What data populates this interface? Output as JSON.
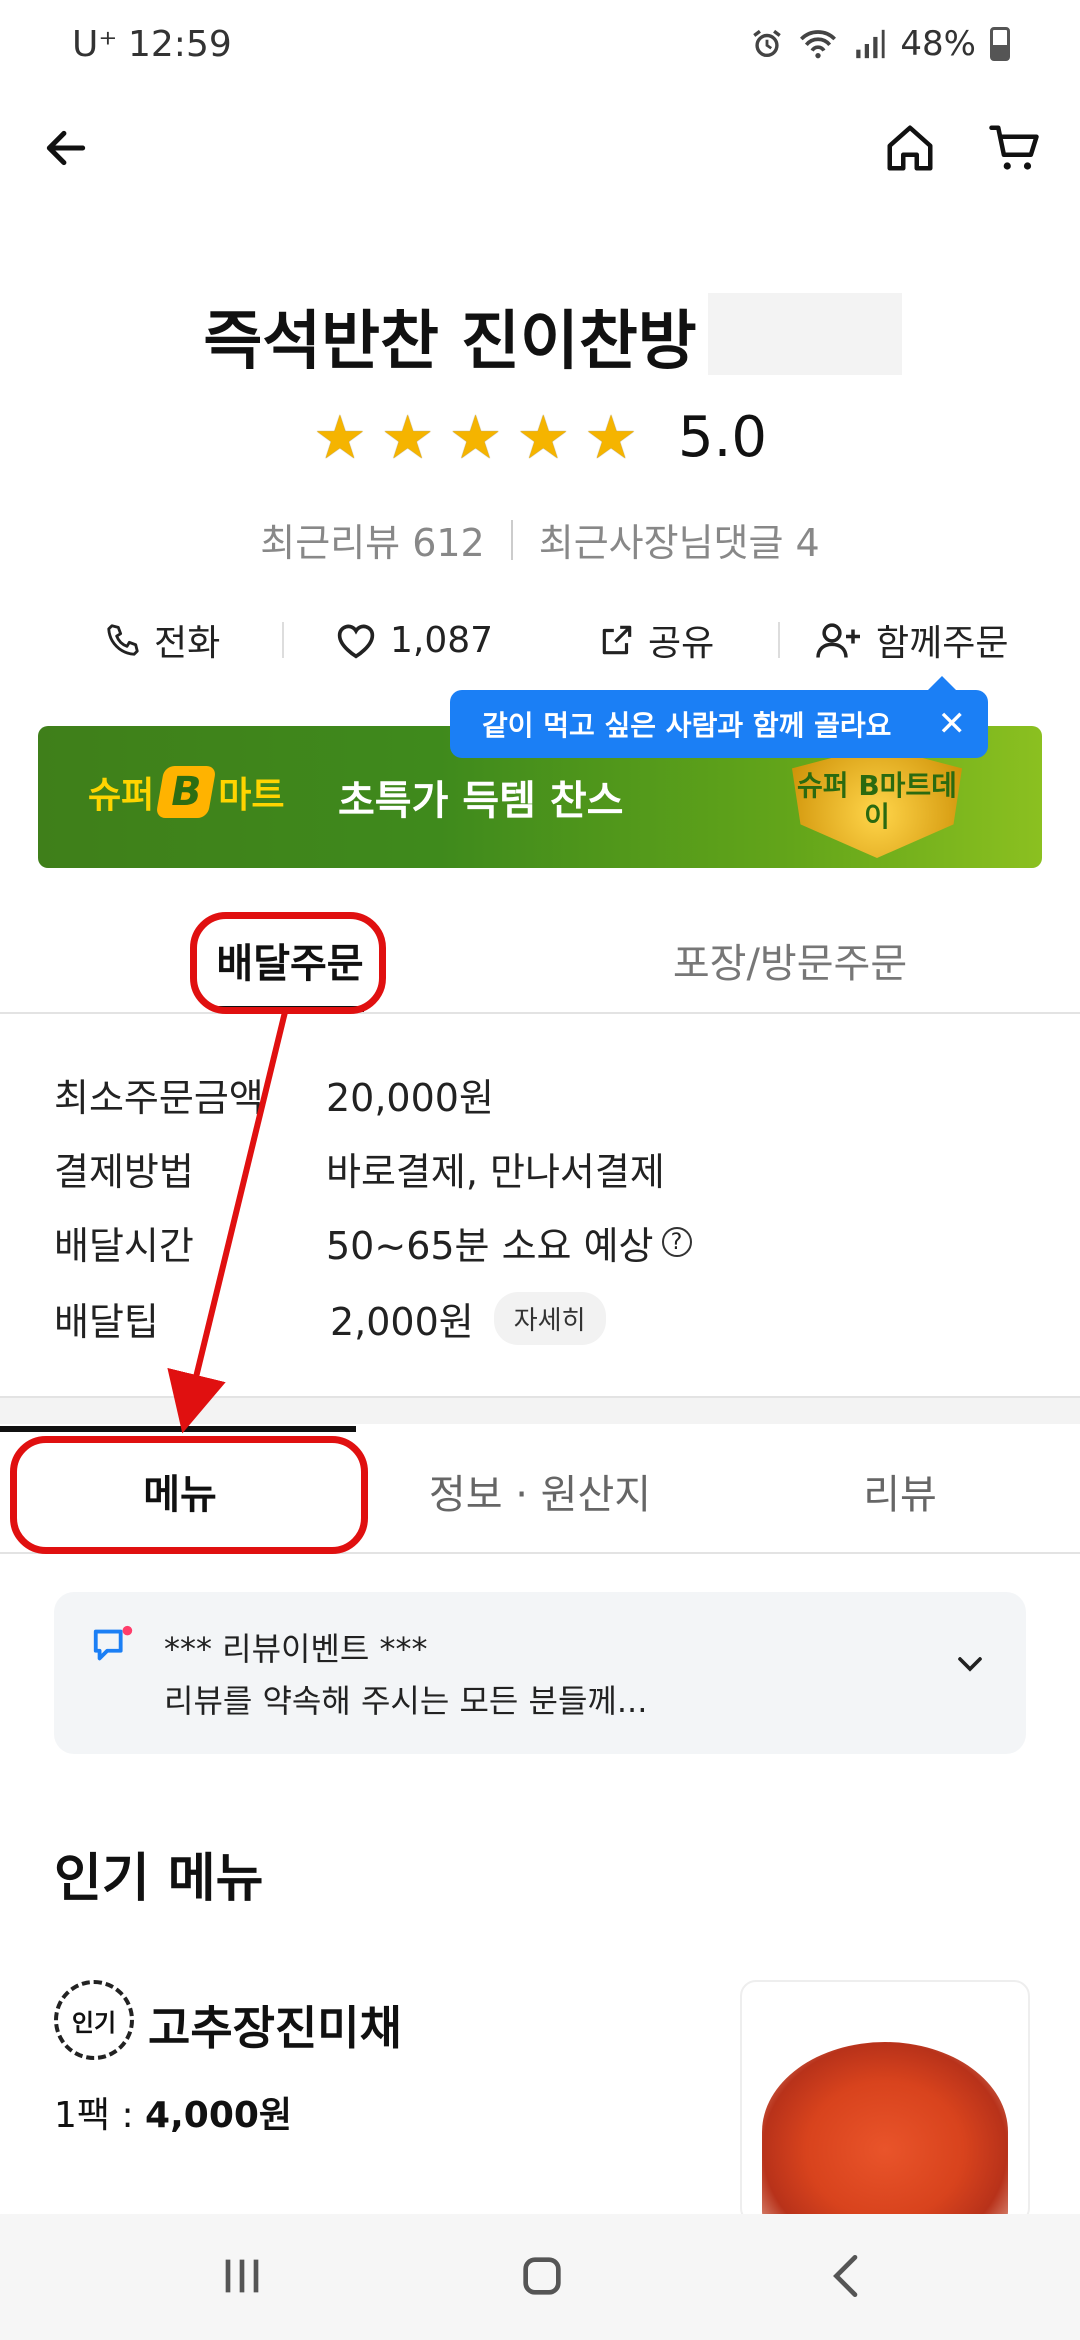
{
  "status_bar": {
    "carrier": "U⁺",
    "time": "12:59",
    "battery": "48%"
  },
  "nav": {
    "back_icon": "arrow-left-icon",
    "home_icon": "home-icon",
    "cart_icon": "cart-icon"
  },
  "store": {
    "name": "즉석반찬 진이찬방",
    "stars": 5,
    "rating": "5.0",
    "recent_reviews": "최근리뷰 612",
    "owner_replies": "최근사장님댓글 4"
  },
  "actions": {
    "call": "전화",
    "likes": "1,087",
    "share": "공유",
    "group_order": "함께주문"
  },
  "tooltip": {
    "text": "같이 먹고 싶은 사람과 함께 골라요"
  },
  "banner": {
    "brand_left": "슈퍼",
    "brand_b": "B",
    "brand_right": "마트",
    "text": "초특가 득템 찬스",
    "emblem": "슈퍼 B마트데이"
  },
  "order_tabs": {
    "delivery": "배달주문",
    "pickup": "포장/방문주문"
  },
  "info": {
    "min_order_label": "최소주문금액",
    "min_order_value": "20,000원",
    "payment_label": "결제방법",
    "payment_value": "바로결제, 만나서결제",
    "time_label": "배달시간",
    "time_value": "50~65분 소요 예상",
    "tip_label": "배달팁",
    "tip_value": "2,000원",
    "tip_detail": "자세히"
  },
  "menu_tabs": {
    "menu": "메뉴",
    "info": "정보 · 원산지",
    "review": "리뷰"
  },
  "notice": {
    "title": "*** 리뷰이벤트 ***",
    "body": "리뷰를 약속해 주시는 모든 분들께..."
  },
  "popular": {
    "title": "인기 메뉴",
    "badge": "인기",
    "item_name": "고추장진미채",
    "price_unit": "1팩 : ",
    "price": "4,000원"
  },
  "colors": {
    "accent_blue": "#1b7ff5",
    "annotation_red": "#e01010",
    "star": "#f5b400"
  }
}
